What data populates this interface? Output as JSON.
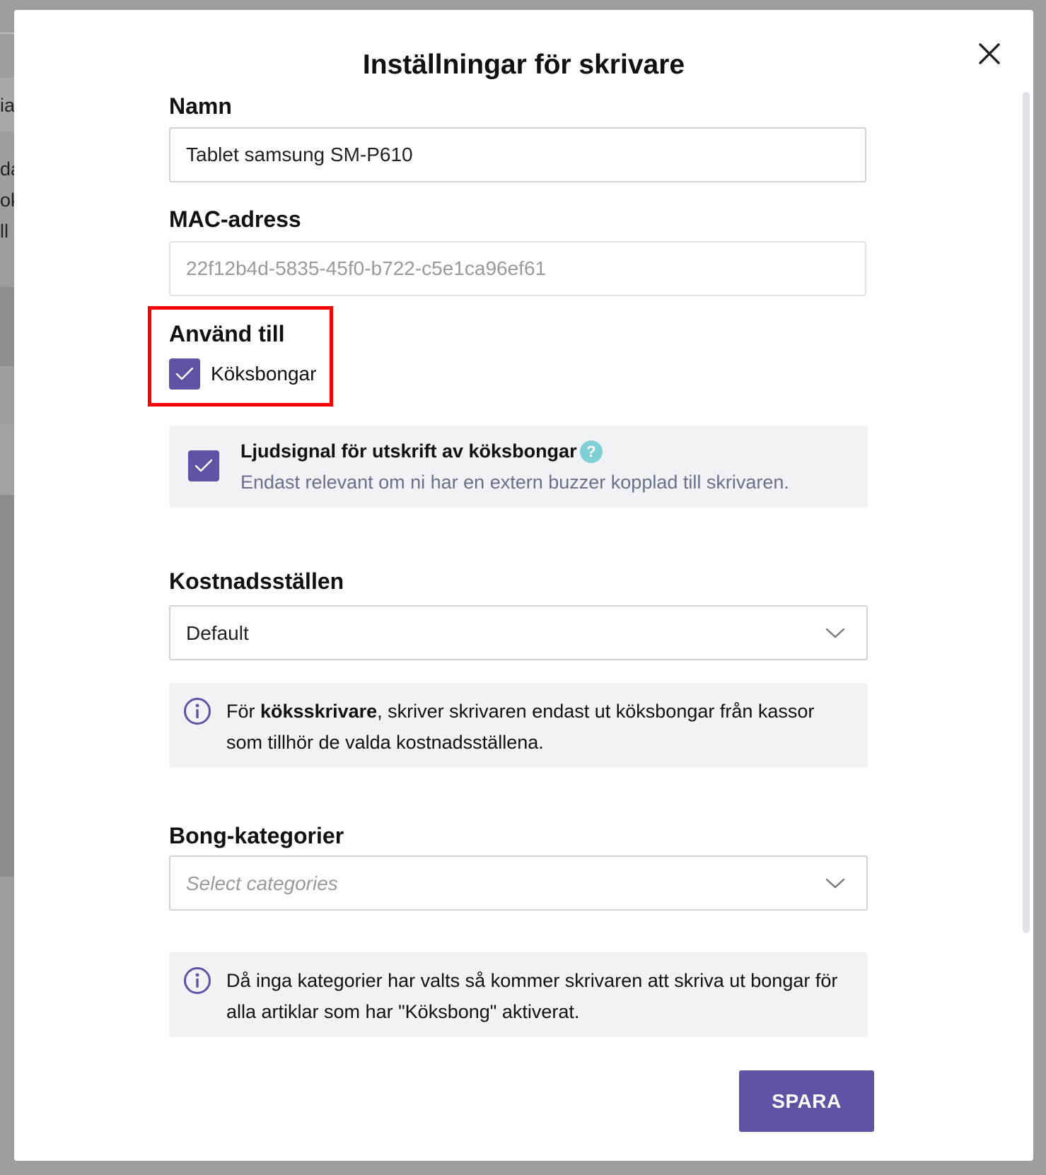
{
  "background": {
    "fragments": [
      "ia",
      "da",
      "ok",
      "ll"
    ]
  },
  "modal": {
    "title": "Inställningar för skrivare",
    "close_icon": "close-icon"
  },
  "name_field": {
    "label": "Namn",
    "value": "Tablet samsung SM-P610"
  },
  "mac_field": {
    "label": "MAC-adress",
    "value": "22f12b4d-5835-45f0-b722-c5e1ca96ef61"
  },
  "use_for": {
    "label": "Använd till",
    "kitchen_tickets_label": "Köksbongar",
    "kitchen_tickets_checked": true
  },
  "buzzer": {
    "title": "Ljudsignal för utskrift av köksbongar",
    "description": "Endast relevant om ni har en extern buzzer kopplad till skrivaren.",
    "checked": true,
    "help_icon": "?"
  },
  "cost_centers": {
    "label": "Kostnadsställen",
    "selected": "Default",
    "info_prefix": "För ",
    "info_bold": "köksskrivare",
    "info_line1_rest": ", skriver skrivaren endast ut köksbongar från kassor",
    "info_line2": "som tillhör de valda kostnadsställena."
  },
  "ticket_categories": {
    "label": "Bong-kategorier",
    "placeholder": "Select categories",
    "info_line1": "Då inga kategorier har valts så kommer skrivaren att skriva ut bongar för",
    "info_line2": "alla artiklar som har \"Köksbong\" aktiverat."
  },
  "actions": {
    "save_label": "SPARA"
  },
  "colors": {
    "accent": "#5f53a6",
    "highlight": "#ff0000",
    "panel": "#f1f2f6",
    "help": "#7fcfd6"
  }
}
